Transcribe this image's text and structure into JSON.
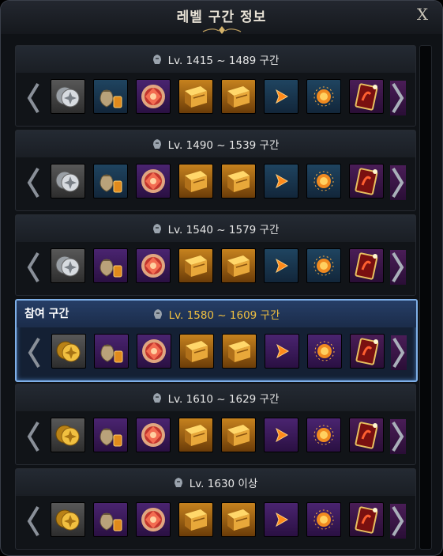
{
  "window": {
    "title": "레벨 구간 정보",
    "close_label": "X"
  },
  "active_label": "참여 구간",
  "sections": [
    {
      "label": "Lv. 1415 ~ 1489 구간",
      "active": false,
      "items": [
        "silver-coins-icon",
        "coin-pouch-icon",
        "ruby-gem-icon",
        "gold-book-icon",
        "gold-book-icon",
        "orange-arrow-icon",
        "fire-orb-icon",
        "card-icon"
      ],
      "frames": [
        "g",
        "b",
        "p",
        "o",
        "o",
        "b",
        "b",
        "r"
      ]
    },
    {
      "label": "Lv. 1490 ~ 1539 구간",
      "active": false,
      "items": [
        "silver-coins-icon",
        "coin-pouch-icon",
        "ruby-gem-icon",
        "gold-book-icon",
        "gold-book-icon",
        "orange-arrow-icon",
        "fire-orb-icon",
        "card-icon"
      ],
      "frames": [
        "g",
        "b",
        "p",
        "o",
        "o",
        "b",
        "b",
        "r"
      ]
    },
    {
      "label": "Lv. 1540 ~ 1579 구간",
      "active": false,
      "items": [
        "silver-coins-icon",
        "coin-pouch-icon",
        "ruby-gem-icon",
        "gold-book-icon",
        "gold-book-icon",
        "orange-arrow-icon",
        "fire-orb-icon",
        "card-icon"
      ],
      "frames": [
        "g",
        "p",
        "p",
        "o",
        "o",
        "b",
        "b",
        "r"
      ]
    },
    {
      "label": "Lv. 1580 ~ 1609 구간",
      "active": true,
      "items": [
        "gold-coins-icon",
        "coin-pouch-icon",
        "ruby-gem-icon",
        "gold-book-icon",
        "gold-book-icon",
        "orange-arrow-icon",
        "fire-orb-icon",
        "card-icon"
      ],
      "frames": [
        "g",
        "p",
        "p",
        "o",
        "o",
        "p",
        "p",
        "r"
      ]
    },
    {
      "label": "Lv. 1610 ~ 1629 구간",
      "active": false,
      "items": [
        "gold-coins-icon",
        "coin-pouch-icon",
        "ruby-gem-icon",
        "gold-book-icon",
        "gold-book-icon",
        "orange-arrow-icon",
        "fire-orb-icon",
        "card-icon"
      ],
      "frames": [
        "g",
        "p",
        "p",
        "o",
        "o",
        "p",
        "p",
        "r"
      ]
    },
    {
      "label": "Lv. 1630 이상",
      "active": false,
      "items": [
        "gold-coins-icon",
        "coin-pouch-icon",
        "ruby-gem-icon",
        "gold-book-icon",
        "gold-book-icon",
        "orange-arrow-icon",
        "fire-orb-icon",
        "card-icon"
      ],
      "frames": [
        "g",
        "p",
        "p",
        "o",
        "o",
        "p",
        "p",
        "r"
      ]
    }
  ],
  "colors": {
    "accent": "#f0c040",
    "active_border": "#7fb0e8"
  }
}
